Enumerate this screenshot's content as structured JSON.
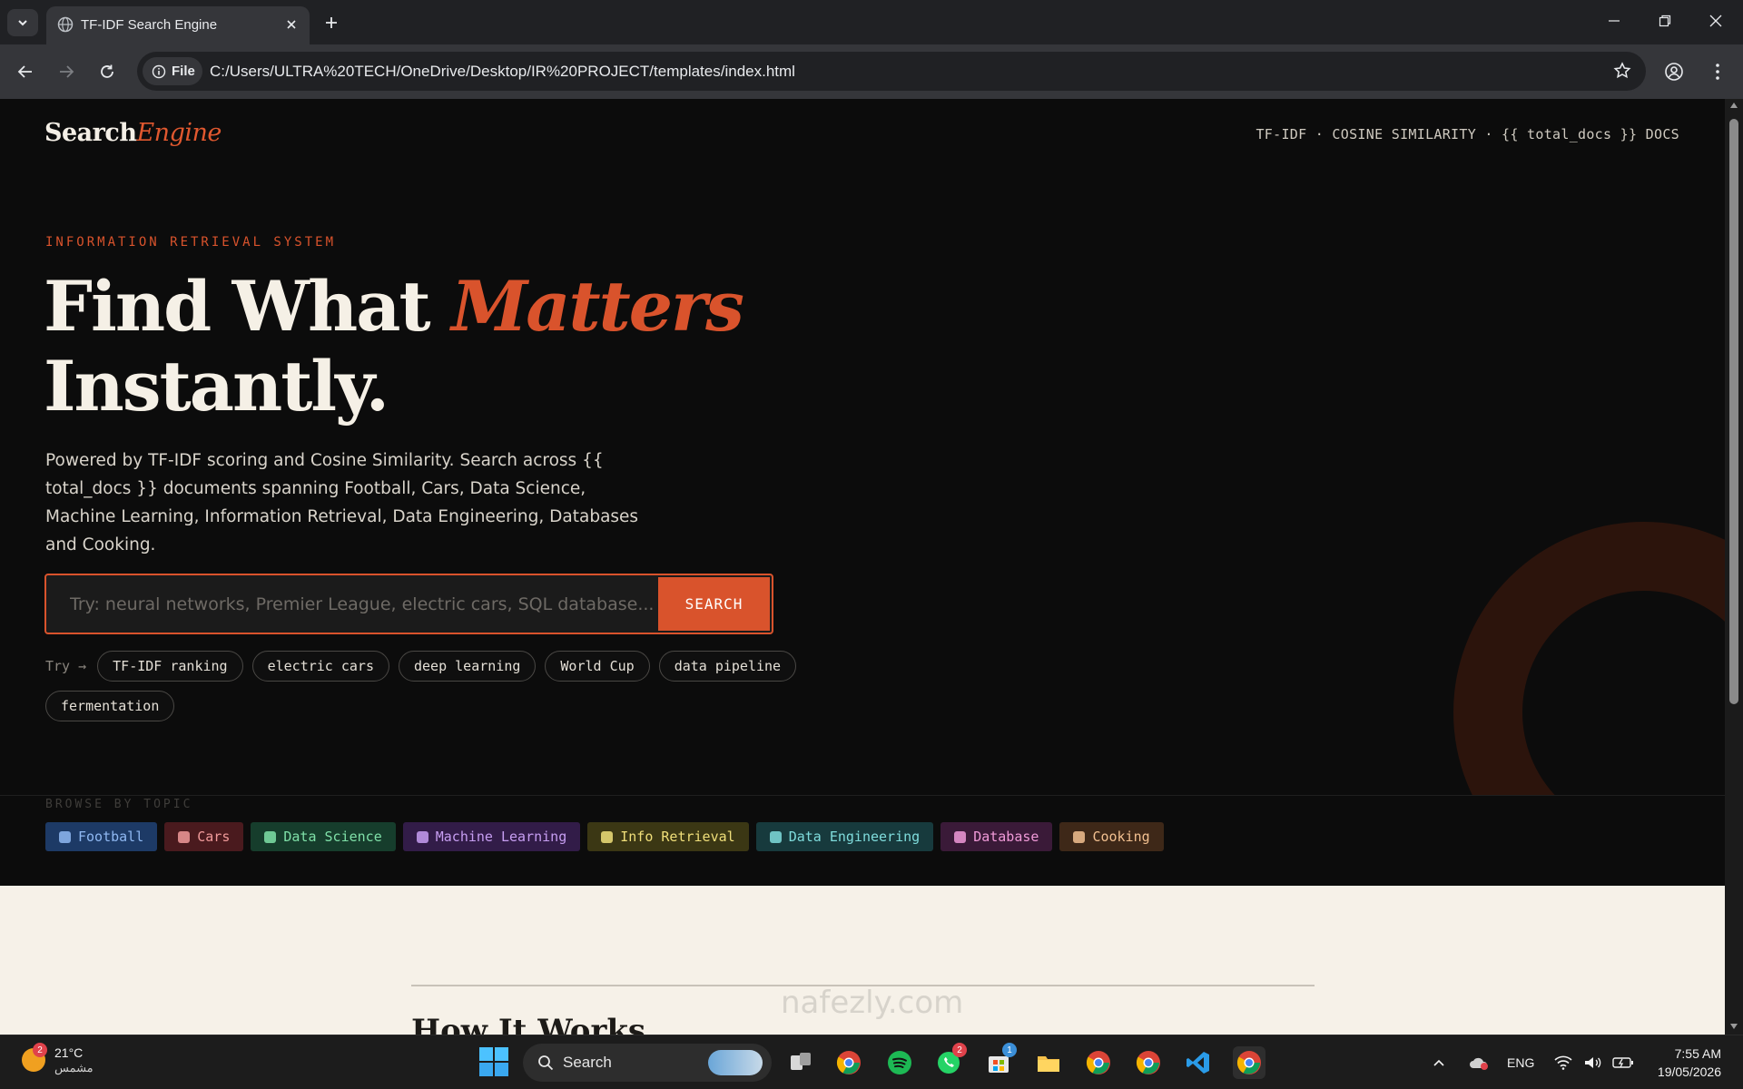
{
  "browser": {
    "tab_title": "TF-IDF Search Engine",
    "file_chip": "File",
    "url": "C:/Users/ULTRA%20TECH/OneDrive/Desktop/IR%20PROJECT/templates/index.html"
  },
  "page": {
    "logo_main": "Search",
    "logo_accent": "Engine",
    "top_meta": "TF-IDF · COSINE SIMILARITY · {{ total_docs }} DOCS",
    "eyebrow": "INFORMATION RETRIEVAL SYSTEM",
    "headline_part1": "Find What ",
    "headline_accent": "Matters",
    "headline_part2": "Instantly.",
    "lede": "Powered by TF-IDF scoring and Cosine Similarity. Search across {{ total_docs }} documents spanning Football, Cars, Data Science, Machine Learning, Information Retrieval, Data Engineering, Databases and Cooking.",
    "search_placeholder": "Try: neural networks, Premier League, electric cars, SQL database...",
    "search_button": "SEARCH",
    "try_label": "Try →",
    "suggestions": [
      "TF-IDF ranking",
      "electric cars",
      "deep learning",
      "World Cup",
      "data pipeline",
      "fermentation"
    ],
    "browse_label": "BROWSE BY TOPIC",
    "topics": [
      {
        "label": "Football",
        "icon": "soccer-ball-icon",
        "bg": "#1d3a66",
        "fg": "#8fb8f2"
      },
      {
        "label": "Cars",
        "icon": "car-icon",
        "bg": "#4a1a1e",
        "fg": "#f09a9a"
      },
      {
        "label": "Data Science",
        "icon": "bar-chart-icon",
        "bg": "#163d2c",
        "fg": "#7fe0a8"
      },
      {
        "label": "Machine Learning",
        "icon": "robot-icon",
        "bg": "#321c48",
        "fg": "#c79ef2"
      },
      {
        "label": "Info Retrieval",
        "icon": "magnifier-icon",
        "bg": "#3b3714",
        "fg": "#f0df7a"
      },
      {
        "label": "Data Engineering",
        "icon": "gear-icon",
        "bg": "#173a3d",
        "fg": "#7fdcdc"
      },
      {
        "label": "Database",
        "icon": "database-icon",
        "bg": "#3a1a38",
        "fg": "#f09ad8"
      },
      {
        "label": "Cooking",
        "icon": "search-icon",
        "bg": "#3e2818",
        "fg": "#f2c090"
      }
    ],
    "section_heading": "How It Works"
  },
  "watermark": "nafezly.com",
  "taskbar": {
    "weather_temp": "21°C",
    "weather_cond": "مشمس",
    "weather_badge": "2",
    "search_label": "Search",
    "whatsapp_badge": "2",
    "store_badge": "1",
    "lang": "ENG",
    "time": "7:55 AM",
    "date": "19/05/2026"
  },
  "colors": {
    "accent": "#d9532c",
    "background": "#0c0c0c",
    "cream": "#f6f1e8"
  }
}
